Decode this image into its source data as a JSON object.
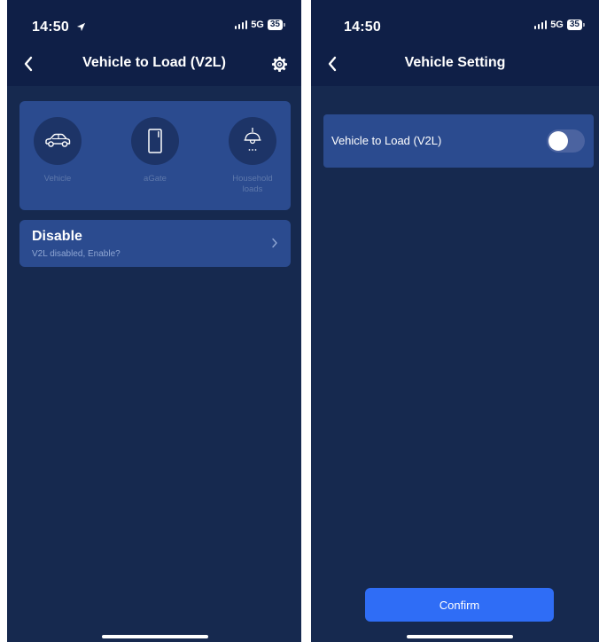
{
  "left_screen": {
    "status_bar": {
      "time": "14:50",
      "network": "5G",
      "battery": "35"
    },
    "nav": {
      "title": "Vehicle to Load (V2L)"
    },
    "flow": {
      "vehicle_label": "Vehicle",
      "agate_label": "aGate",
      "household_label": "Household loads"
    },
    "status_row": {
      "title": "Disable",
      "subtitle": "V2L disabled, Enable?"
    }
  },
  "right_screen": {
    "status_bar": {
      "time": "14:50",
      "network": "5G",
      "battery": "35"
    },
    "nav": {
      "title": "Vehicle Setting"
    },
    "setting": {
      "label": "Vehicle to Load (V2L)",
      "enabled": false
    },
    "confirm_label": "Confirm"
  },
  "colors": {
    "background": "#16294f",
    "header": "#0f1f47",
    "card": "#2b4b8f",
    "accent": "#2f6df6"
  }
}
